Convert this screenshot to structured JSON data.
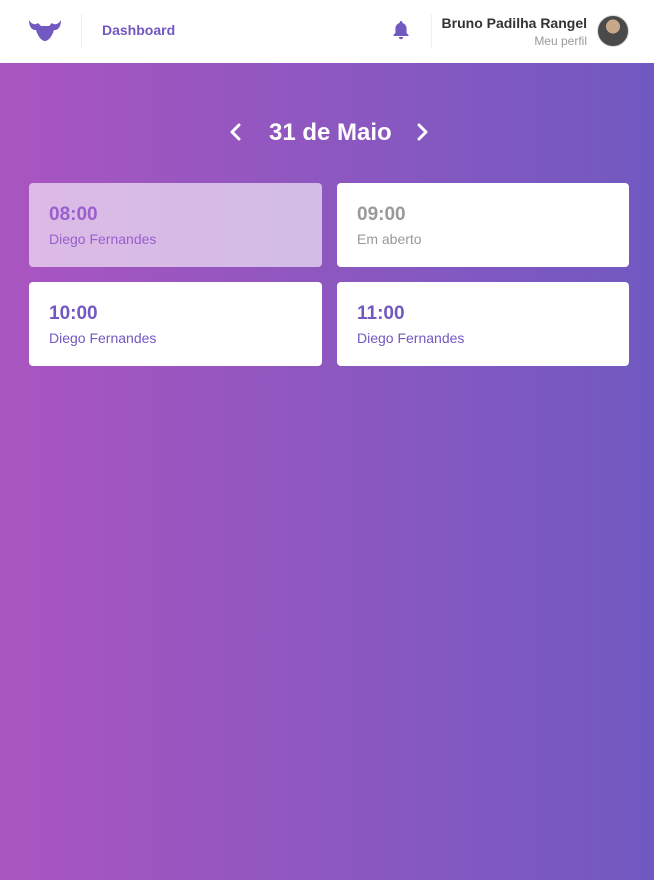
{
  "header": {
    "nav_label": "Dashboard",
    "profile": {
      "name": "Bruno Padilha Rangel",
      "link_label": "Meu perfil"
    },
    "icons": {
      "logo": "mustache-logo-icon",
      "notifications": "bell-icon"
    }
  },
  "date_nav": {
    "title": "31 de Maio",
    "prev_icon": "chevron-left-icon",
    "next_icon": "chevron-right-icon"
  },
  "slots": [
    {
      "time": "08:00",
      "label": "Diego Fernandes",
      "state": "selected"
    },
    {
      "time": "09:00",
      "label": "Em aberto",
      "state": "available"
    },
    {
      "time": "10:00",
      "label": "Diego Fernandes",
      "state": "booked"
    },
    {
      "time": "11:00",
      "label": "Diego Fernandes",
      "state": "booked"
    }
  ],
  "colors": {
    "accent": "#7159c1",
    "gradient_start": "#aa55c0",
    "gradient_end": "#7159c1",
    "header_bg": "#ffffff",
    "muted_text": "#999999"
  }
}
